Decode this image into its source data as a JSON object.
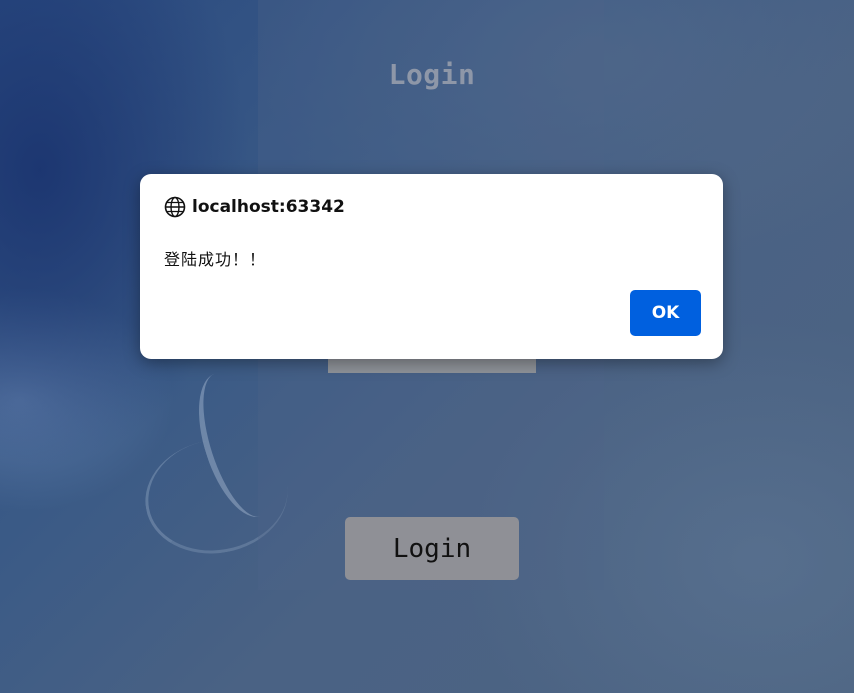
{
  "page": {
    "title": "Login",
    "login_button_label": "Login"
  },
  "dialog": {
    "origin": "localhost:63342",
    "message": "登陆成功！！",
    "ok_label": "OK",
    "icon": "globe-icon"
  },
  "colors": {
    "ok_button": "#0060df",
    "login_button": "#8f9096",
    "page_title": "#8e97a8"
  }
}
